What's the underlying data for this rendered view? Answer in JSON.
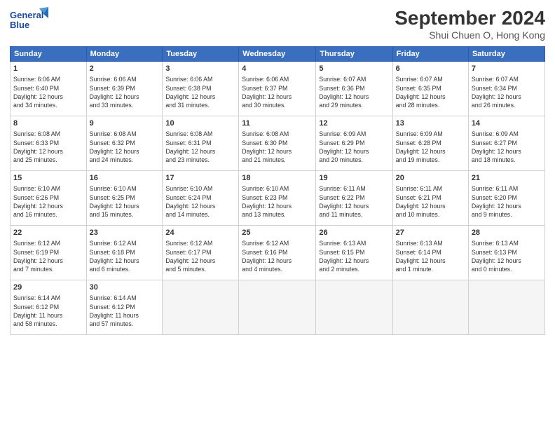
{
  "header": {
    "logo_line1": "General",
    "logo_line2": "Blue",
    "month_title": "September 2024",
    "subtitle": "Shui Chuen O, Hong Kong"
  },
  "weekdays": [
    "Sunday",
    "Monday",
    "Tuesday",
    "Wednesday",
    "Thursday",
    "Friday",
    "Saturday"
  ],
  "weeks": [
    [
      {
        "day": "1",
        "info": "Sunrise: 6:06 AM\nSunset: 6:40 PM\nDaylight: 12 hours\nand 34 minutes."
      },
      {
        "day": "2",
        "info": "Sunrise: 6:06 AM\nSunset: 6:39 PM\nDaylight: 12 hours\nand 33 minutes."
      },
      {
        "day": "3",
        "info": "Sunrise: 6:06 AM\nSunset: 6:38 PM\nDaylight: 12 hours\nand 31 minutes."
      },
      {
        "day": "4",
        "info": "Sunrise: 6:06 AM\nSunset: 6:37 PM\nDaylight: 12 hours\nand 30 minutes."
      },
      {
        "day": "5",
        "info": "Sunrise: 6:07 AM\nSunset: 6:36 PM\nDaylight: 12 hours\nand 29 minutes."
      },
      {
        "day": "6",
        "info": "Sunrise: 6:07 AM\nSunset: 6:35 PM\nDaylight: 12 hours\nand 28 minutes."
      },
      {
        "day": "7",
        "info": "Sunrise: 6:07 AM\nSunset: 6:34 PM\nDaylight: 12 hours\nand 26 minutes."
      }
    ],
    [
      {
        "day": "8",
        "info": "Sunrise: 6:08 AM\nSunset: 6:33 PM\nDaylight: 12 hours\nand 25 minutes."
      },
      {
        "day": "9",
        "info": "Sunrise: 6:08 AM\nSunset: 6:32 PM\nDaylight: 12 hours\nand 24 minutes."
      },
      {
        "day": "10",
        "info": "Sunrise: 6:08 AM\nSunset: 6:31 PM\nDaylight: 12 hours\nand 23 minutes."
      },
      {
        "day": "11",
        "info": "Sunrise: 6:08 AM\nSunset: 6:30 PM\nDaylight: 12 hours\nand 21 minutes."
      },
      {
        "day": "12",
        "info": "Sunrise: 6:09 AM\nSunset: 6:29 PM\nDaylight: 12 hours\nand 20 minutes."
      },
      {
        "day": "13",
        "info": "Sunrise: 6:09 AM\nSunset: 6:28 PM\nDaylight: 12 hours\nand 19 minutes."
      },
      {
        "day": "14",
        "info": "Sunrise: 6:09 AM\nSunset: 6:27 PM\nDaylight: 12 hours\nand 18 minutes."
      }
    ],
    [
      {
        "day": "15",
        "info": "Sunrise: 6:10 AM\nSunset: 6:26 PM\nDaylight: 12 hours\nand 16 minutes."
      },
      {
        "day": "16",
        "info": "Sunrise: 6:10 AM\nSunset: 6:25 PM\nDaylight: 12 hours\nand 15 minutes."
      },
      {
        "day": "17",
        "info": "Sunrise: 6:10 AM\nSunset: 6:24 PM\nDaylight: 12 hours\nand 14 minutes."
      },
      {
        "day": "18",
        "info": "Sunrise: 6:10 AM\nSunset: 6:23 PM\nDaylight: 12 hours\nand 13 minutes."
      },
      {
        "day": "19",
        "info": "Sunrise: 6:11 AM\nSunset: 6:22 PM\nDaylight: 12 hours\nand 11 minutes."
      },
      {
        "day": "20",
        "info": "Sunrise: 6:11 AM\nSunset: 6:21 PM\nDaylight: 12 hours\nand 10 minutes."
      },
      {
        "day": "21",
        "info": "Sunrise: 6:11 AM\nSunset: 6:20 PM\nDaylight: 12 hours\nand 9 minutes."
      }
    ],
    [
      {
        "day": "22",
        "info": "Sunrise: 6:12 AM\nSunset: 6:19 PM\nDaylight: 12 hours\nand 7 minutes."
      },
      {
        "day": "23",
        "info": "Sunrise: 6:12 AM\nSunset: 6:18 PM\nDaylight: 12 hours\nand 6 minutes."
      },
      {
        "day": "24",
        "info": "Sunrise: 6:12 AM\nSunset: 6:17 PM\nDaylight: 12 hours\nand 5 minutes."
      },
      {
        "day": "25",
        "info": "Sunrise: 6:12 AM\nSunset: 6:16 PM\nDaylight: 12 hours\nand 4 minutes."
      },
      {
        "day": "26",
        "info": "Sunrise: 6:13 AM\nSunset: 6:15 PM\nDaylight: 12 hours\nand 2 minutes."
      },
      {
        "day": "27",
        "info": "Sunrise: 6:13 AM\nSunset: 6:14 PM\nDaylight: 12 hours\nand 1 minute."
      },
      {
        "day": "28",
        "info": "Sunrise: 6:13 AM\nSunset: 6:13 PM\nDaylight: 12 hours\nand 0 minutes."
      }
    ],
    [
      {
        "day": "29",
        "info": "Sunrise: 6:14 AM\nSunset: 6:12 PM\nDaylight: 11 hours\nand 58 minutes."
      },
      {
        "day": "30",
        "info": "Sunrise: 6:14 AM\nSunset: 6:12 PM\nDaylight: 11 hours\nand 57 minutes."
      },
      {
        "day": "",
        "info": ""
      },
      {
        "day": "",
        "info": ""
      },
      {
        "day": "",
        "info": ""
      },
      {
        "day": "",
        "info": ""
      },
      {
        "day": "",
        "info": ""
      }
    ]
  ]
}
